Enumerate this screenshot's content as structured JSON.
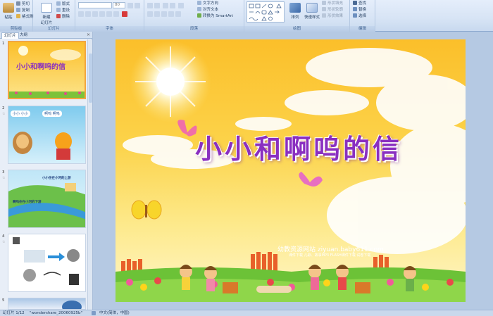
{
  "ribbon": {
    "clipboard": {
      "paste": "粘贴",
      "cut": "剪切",
      "copy": "复制",
      "format_painter": "格式刷",
      "label": "剪贴板"
    },
    "slides": {
      "new_slide": "新建\n幻灯片",
      "layout": "版式",
      "reset": "重设",
      "delete": "删除",
      "label": "幻灯片"
    },
    "font": {
      "font_name": "",
      "font_size": "80",
      "label": "字体"
    },
    "paragraph": {
      "text_direction": "文字方向",
      "align_text": "对齐文本",
      "smartart": "转换为 SmartArt",
      "label": "段落"
    },
    "drawing": {
      "arrange": "排列",
      "quick_styles": "快速样式",
      "shape_fill": "形状填充",
      "shape_outline": "形状轮廓",
      "shape_effects": "形状效果",
      "label": "绘图"
    },
    "editing": {
      "find": "查找",
      "replace": "替换",
      "select": "选择",
      "label": "编辑"
    }
  },
  "left_pane": {
    "tabs": [
      "幻灯片",
      "大纲"
    ],
    "close": "×",
    "thumbnails": [
      {
        "number": "1",
        "title": "小小和啊呜的信"
      },
      {
        "number": "2",
        "bubble1": "小小 小小",
        "bubble2": "啊呜 啊呜"
      },
      {
        "number": "3",
        "text1": "小小住在小河的上游",
        "text2": "啊呜住在小河的下游"
      },
      {
        "number": "4"
      },
      {
        "number": "5"
      }
    ]
  },
  "slide": {
    "title": "小小和啊呜的信",
    "watermark": "幼教资源网站  ziyuan.baby611.com",
    "watermark_sub": "课件下载  儿歌、故事MP3  FLASH课件下载  试卷下载"
  },
  "status_bar": {
    "slide_pos": "幻灯片 1/12",
    "theme": "\"wondershare_20060925b\"",
    "language": "中文(简体，中国)"
  },
  "colors": {
    "ribbon_bg": "#dbe6f4",
    "slide_orange": "#fbbf2a",
    "title_purple": "#8a2fc0",
    "selection": "#f2a640"
  }
}
